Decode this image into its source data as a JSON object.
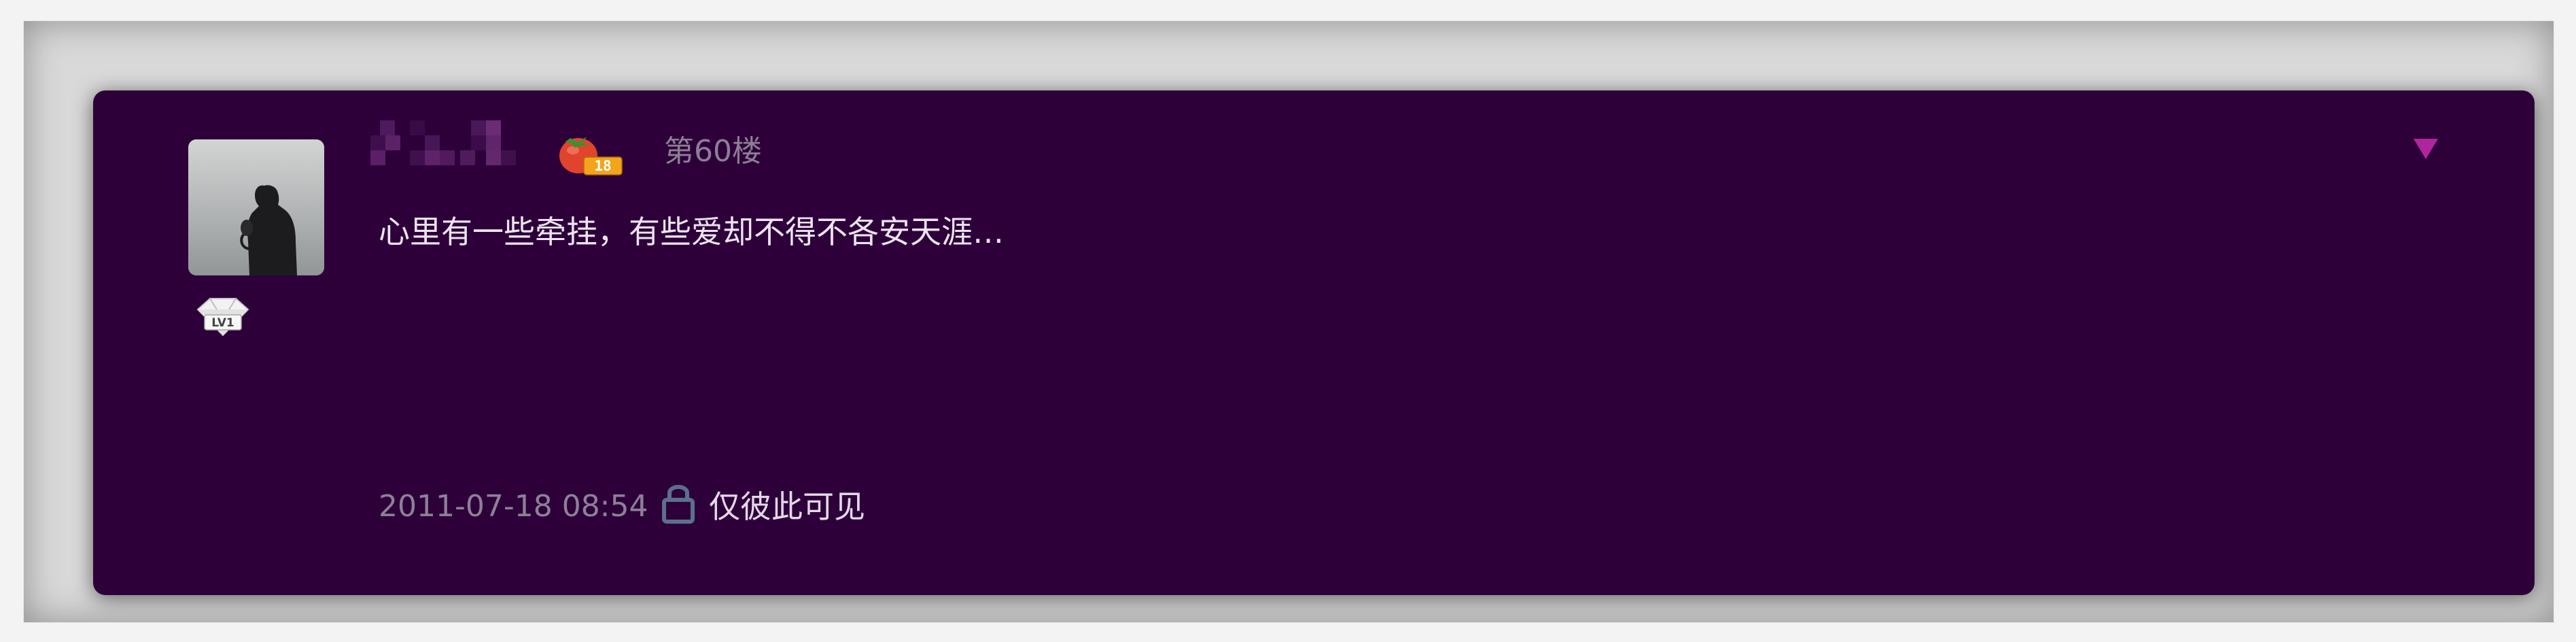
{
  "post": {
    "floor_label": "第60楼",
    "content": "心里有一些牵挂，有些爱却不得不各安天涯…",
    "timestamp": "2011-07-18 08:54",
    "visibility_label": "仅彼此可见"
  },
  "author": {
    "level_badge_text": "LV1",
    "fruit_badge_count": "18"
  },
  "colors": {
    "card_background": "#2d003a",
    "accent_magenta": "#b0259e",
    "lock_blue": "#5c6f8d"
  },
  "icons": {
    "menu": "triangle-down-icon",
    "lock": "lock-icon",
    "level": "diamond-badge-icon",
    "fruit": "tomato-badge-icon"
  }
}
